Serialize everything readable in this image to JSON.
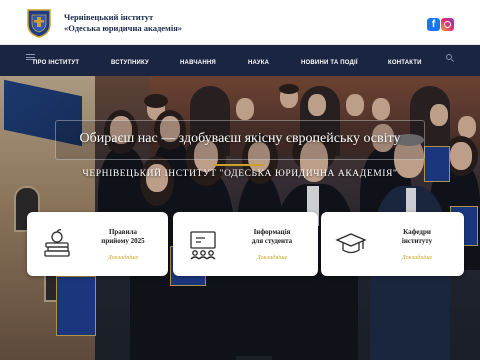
{
  "header": {
    "brand_line1": "Чернівецький інститут",
    "brand_line2": "«Одеська юридична академія»",
    "logo_icon": "crest-logo-icon",
    "social": [
      {
        "name": "facebook-icon",
        "glyph": "f",
        "color": "#1877f2"
      },
      {
        "name": "instagram-icon",
        "glyph": "",
        "color": "#e1306c"
      }
    ]
  },
  "nav": {
    "menu_icon": "hamburger-icon",
    "items": [
      {
        "label": "ПРО ІНСТИТУТ"
      },
      {
        "label": "ВСТУПНИКУ"
      },
      {
        "label": "НАВЧАННЯ"
      },
      {
        "label": "НАУКА"
      },
      {
        "label": "НОВИНИ ТА ПОДІЇ"
      },
      {
        "label": "КОНТАКТИ"
      }
    ],
    "search_icon": "search-icon"
  },
  "hero": {
    "slogan": "Обираєш нас — здобуваєш якісну європейську освіту",
    "subtitle": "ЧЕРНІВЕЦЬКИЙ ІНСТИТУТ \"ОДЕСЬКА ЮРИДИЧНА АКАДЕМІЯ\"",
    "accent_color": "#c9a227"
  },
  "cards": [
    {
      "title_line1": "Правила",
      "title_line2": "прийому 2025",
      "link": "Докладніше",
      "icon": "books-apple-icon"
    },
    {
      "title_line1": "Інформація",
      "title_line2": "для студента",
      "link": "Докладніше",
      "icon": "presentation-board-icon"
    },
    {
      "title_line1": "Кафедри",
      "title_line2": "інституту",
      "link": "Докладніше",
      "icon": "graduation-cap-icon"
    }
  ],
  "colors": {
    "nav_bg": "#1a2542",
    "link_gold": "#c9a227"
  }
}
